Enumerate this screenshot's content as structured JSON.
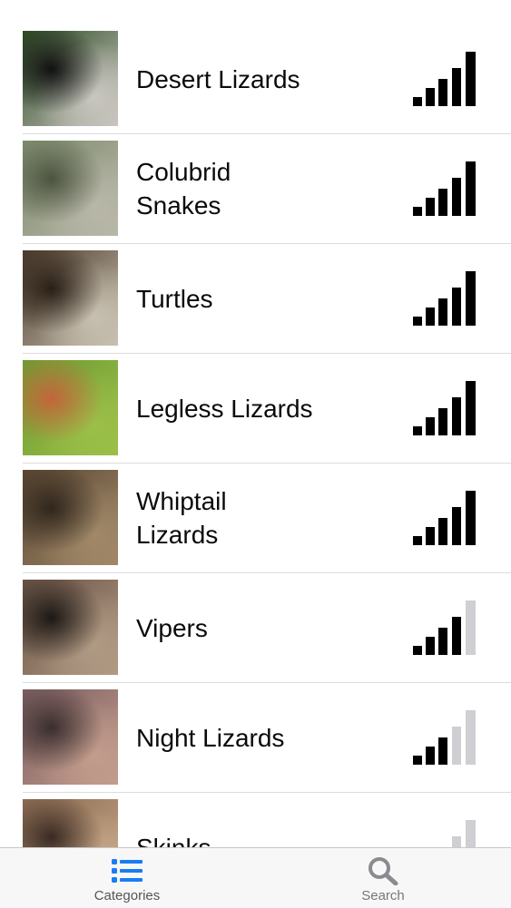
{
  "categories": [
    {
      "label": "Desert Lizards",
      "level": 5,
      "colors": [
        "#2d4a22",
        "#111111",
        "#c9c6c0"
      ]
    },
    {
      "label": "Colubrid\nSnakes",
      "level": 5,
      "colors": [
        "#7d8a6c",
        "#4c5440",
        "#b8b7a8"
      ]
    },
    {
      "label": "Turtles",
      "level": 5,
      "colors": [
        "#4a3a2a",
        "#2a1f16",
        "#c8c0b0"
      ]
    },
    {
      "label": "Legless Lizards",
      "level": 5,
      "colors": [
        "#6d9a32",
        "#c3653a",
        "#9bbf48"
      ]
    },
    {
      "label": "Whiptail\nLizards",
      "level": 5,
      "colors": [
        "#5a4632",
        "#2f261c",
        "#a08868"
      ]
    },
    {
      "label": "Vipers",
      "level": 4,
      "colors": [
        "#6a5244",
        "#1c1814",
        "#b09a84"
      ]
    },
    {
      "label": "Night Lizards",
      "level": 3,
      "colors": [
        "#7a5d60",
        "#3a2e2e",
        "#c29c8c"
      ]
    },
    {
      "label": "Skinks",
      "level": 1,
      "colors": [
        "#8a6a50",
        "#3a2a22",
        "#c9a98a"
      ]
    }
  ],
  "signal_max": 5,
  "tabs": [
    {
      "label": "Categories",
      "icon": "list-icon",
      "color": "#1a7cf5",
      "active": true
    },
    {
      "label": "Search",
      "icon": "search-icon",
      "color": "#8a8a8f",
      "active": false
    }
  ]
}
